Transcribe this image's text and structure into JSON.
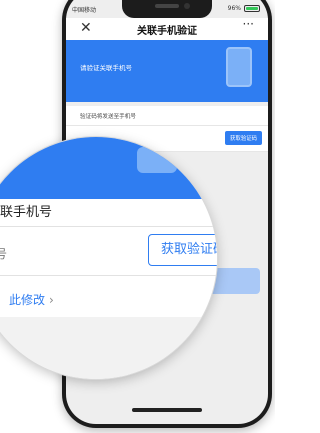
{
  "status_bar": {
    "carrier": "中国移动",
    "battery": "96%",
    "battery_level": 0.96
  },
  "nav": {
    "title": "关联手机验证",
    "close": "✕",
    "more": "···"
  },
  "banner": {
    "text": "请验证关联手机号",
    "icon": "phone-icon"
  },
  "form": {
    "hint": "验证码将发送至手机号",
    "get_code_label": "获取验证码"
  },
  "magnifier": {
    "field_label": "关联手机号",
    "code_label": "号",
    "get_code_label": "获取验证码",
    "link_text": "此修改",
    "link_chevron": "›"
  },
  "colors": {
    "accent": "#2f7df1",
    "button_disabled": "#a9c8f6"
  }
}
